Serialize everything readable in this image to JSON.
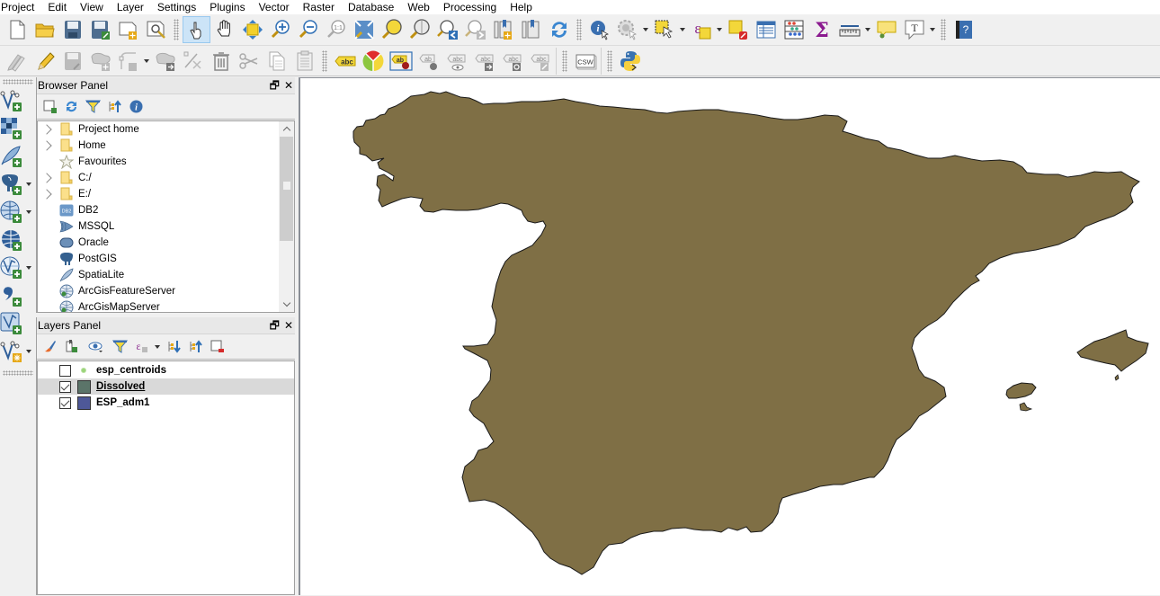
{
  "menubar": {
    "items": [
      "Project",
      "Edit",
      "View",
      "Layer",
      "Settings",
      "Plugins",
      "Vector",
      "Raster",
      "Database",
      "Web",
      "Processing",
      "Help"
    ]
  },
  "toolbar_row1": {
    "file": [
      "new-project",
      "open-project",
      "save-project",
      "save-project-as",
      "new-print-composer",
      "composer-manager"
    ],
    "navigation": [
      "touch-zoom-pan",
      "pan-map",
      "pan-to-selection",
      "zoom-in",
      "zoom-out",
      "zoom-actual-size",
      "zoom-full",
      "zoom-to-selection",
      "zoom-to-layer",
      "zoom-last",
      "zoom-next",
      "new-bookmark",
      "show-bookmarks",
      "refresh"
    ],
    "attributes": [
      "identify-features",
      "run-feature-action",
      "select-features",
      "select-by-expression",
      "deselect-all",
      "open-attribute-table",
      "open-field-calculator",
      "statistical-summary",
      "measure-line",
      "map-tips",
      "text-annotation"
    ],
    "help": [
      "help-contents"
    ]
  },
  "toolbar_row2": {
    "digitizing": [
      "current-edits",
      "toggle-editing",
      "save-layer-edits",
      "add-feature",
      "node-tool",
      "move-feature",
      "delete-ring",
      "delete-selected",
      "cut-features",
      "copy-features",
      "paste-features"
    ],
    "labels": [
      "layer-labeling",
      "layer-diagram",
      "highlight-pinned-labels",
      "pin-unpin-labels",
      "show-hide-labels",
      "move-label",
      "rotate-label",
      "change-label"
    ],
    "web": [
      "csw-metasearch"
    ],
    "plugins": [
      "python-console"
    ],
    "csw_label": "CSW"
  },
  "left_toolbar": {
    "items": [
      "add-vector-layer",
      "add-raster-layer",
      "add-spatialite-layer",
      "add-postgis-layer",
      "add-wms-layer",
      "add-wcs-layer",
      "add-wfs-layer",
      "add-delimited-text-layer",
      "add-virtual-layer",
      "new-shapefile-layer"
    ]
  },
  "browser_panel": {
    "title": "Browser Panel",
    "float_icon": "🗗",
    "close_icon": "✕",
    "tools": [
      "add-selected-layers",
      "refresh",
      "filter-browser",
      "collapse-all",
      "enable-properties-widget"
    ],
    "items": [
      {
        "label": "Project home",
        "icon": "folder",
        "expandable": true
      },
      {
        "label": "Home",
        "icon": "folder",
        "expandable": true
      },
      {
        "label": "Favourites",
        "icon": "star",
        "expandable": false
      },
      {
        "label": "C:/",
        "icon": "folder",
        "expandable": true
      },
      {
        "label": "E:/",
        "icon": "folder",
        "expandable": true
      },
      {
        "label": "DB2",
        "icon": "db2",
        "expandable": false
      },
      {
        "label": "MSSQL",
        "icon": "mssql",
        "expandable": false
      },
      {
        "label": "Oracle",
        "icon": "oracle",
        "expandable": false
      },
      {
        "label": "PostGIS",
        "icon": "postgis",
        "expandable": false
      },
      {
        "label": "SpatiaLite",
        "icon": "spatialite",
        "expandable": false
      },
      {
        "label": "ArcGisFeatureServer",
        "icon": "arcgis",
        "expandable": false
      },
      {
        "label": "ArcGisMapServer",
        "icon": "arcgis",
        "expandable": false
      }
    ],
    "db2_icon_text": "DB2"
  },
  "layers_panel": {
    "title": "Layers Panel",
    "float_icon": "🗗",
    "close_icon": "✕",
    "tools": [
      "open-layer-styling",
      "add-group",
      "manage-map-themes",
      "filter-legend",
      "filter-legend-by-expression",
      "expand-all",
      "collapse-all",
      "remove-layer"
    ],
    "layers": [
      {
        "name": "esp_centroids",
        "checked": false,
        "symbol": "point",
        "color": "#9bd47a",
        "selected": false
      },
      {
        "name": "Dissolved",
        "checked": true,
        "symbol": "polygon",
        "color": "#5b7469",
        "selected": true
      },
      {
        "name": "ESP_adm1",
        "checked": true,
        "symbol": "polygon",
        "color": "#4e5898",
        "selected": false
      }
    ]
  },
  "map": {
    "layer_fill": "#7f6f45",
    "layer_stroke": "#1a1a1a",
    "background": "#ffffff"
  }
}
